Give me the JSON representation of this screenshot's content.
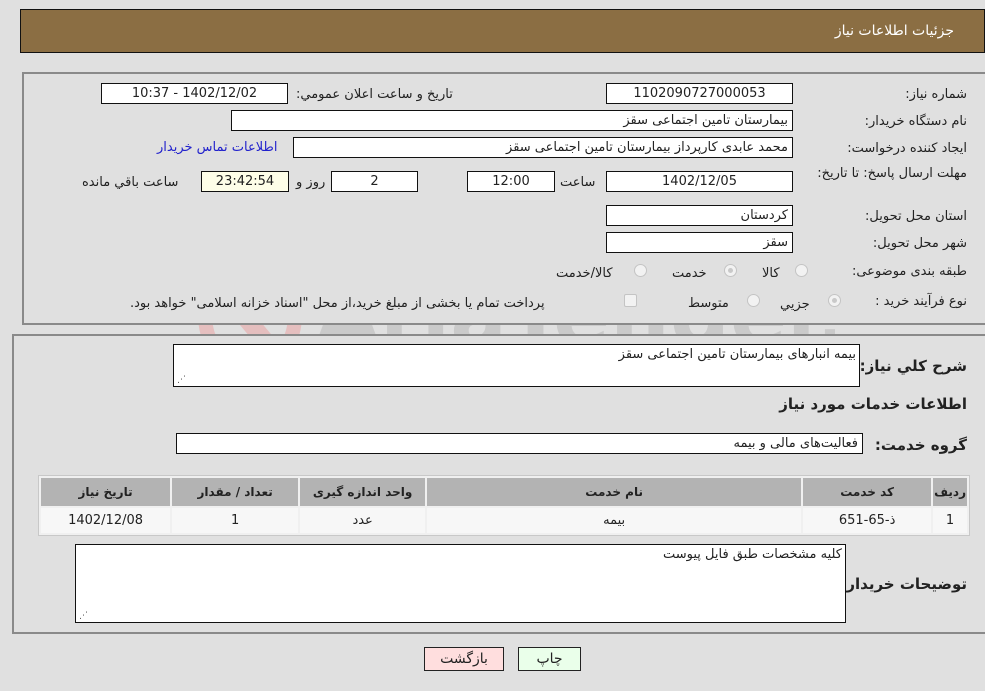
{
  "header": {
    "title": "جزئیات اطلاعات نیاز"
  },
  "form": {
    "need_number_label": "شماره نیاز:",
    "need_number": "1102090727000053",
    "announce_label": "تاریخ و ساعت اعلان عمومي:",
    "announce_value": "1402/12/02 - 10:37",
    "buyer_org_label": "نام دستگاه خریدار:",
    "buyer_org": "بیمارستان تامین اجتماعی سقز",
    "creator_label": "ایجاد کننده درخواست:",
    "creator": "محمد عابدی کارپرداز بیمارستان تامین اجتماعی سقز",
    "contact_link": "اطلاعات تماس خریدار",
    "deadline_label": "مهلت ارسال پاسخ: تا تاریخ:",
    "deadline_date": "1402/12/05",
    "time_label": "ساعت",
    "deadline_time": "12:00",
    "days_value": "2",
    "days_label": "روز و",
    "remaining_time": "23:42:54",
    "remaining_label": "ساعت باقي مانده",
    "province_label": "استان محل تحویل:",
    "province": "کردستان",
    "city_label": "شهر محل تحویل:",
    "city": "سقز",
    "category_label": "طبقه بندی موضوعی:",
    "category_options": [
      {
        "label": "کالا",
        "checked": false
      },
      {
        "label": "خدمت",
        "checked": true
      },
      {
        "label": "کالا/خدمت",
        "checked": false
      }
    ],
    "process_label": "نوع فرآیند خرید :",
    "process_options": [
      {
        "label": "جزيي",
        "checked": true
      },
      {
        "label": "متوسط",
        "checked": false
      }
    ],
    "treasury_note": "پرداخت تمام یا بخشی از مبلغ خرید،از محل \"اسناد خزانه اسلامی\" خواهد بود."
  },
  "details": {
    "summary_label": "شرح کلي نياز:",
    "summary": "بیمه انبارهای بیمارستان تامین اجتماعی سقز",
    "services_heading": "اطلاعات خدمات مورد نیاز",
    "service_group_label": "گروه خدمت:",
    "service_group": "فعالیت‌های مالی و بیمه",
    "table": {
      "headers": [
        "ردیف",
        "کد خدمت",
        "نام خدمت",
        "واحد اندازه گیری",
        "تعداد / مقدار",
        "تاریخ نیاز"
      ],
      "rows": [
        [
          "1",
          "ذ-65-651",
          "بیمه",
          "عدد",
          "1",
          "1402/12/08"
        ]
      ]
    },
    "buyer_notes_label": "توضیحات خریدار:",
    "buyer_notes": "کلیه مشخصات طبق فایل پیوست"
  },
  "buttons": {
    "print": "چاپ",
    "back": "بازگشت"
  },
  "watermark": {
    "text": "AriaTender.neT"
  },
  "colors": {
    "header_bg": "#8b6e43",
    "print_bg": "#eaffea",
    "back_bg": "#ffdede",
    "link": "#2222cc"
  }
}
